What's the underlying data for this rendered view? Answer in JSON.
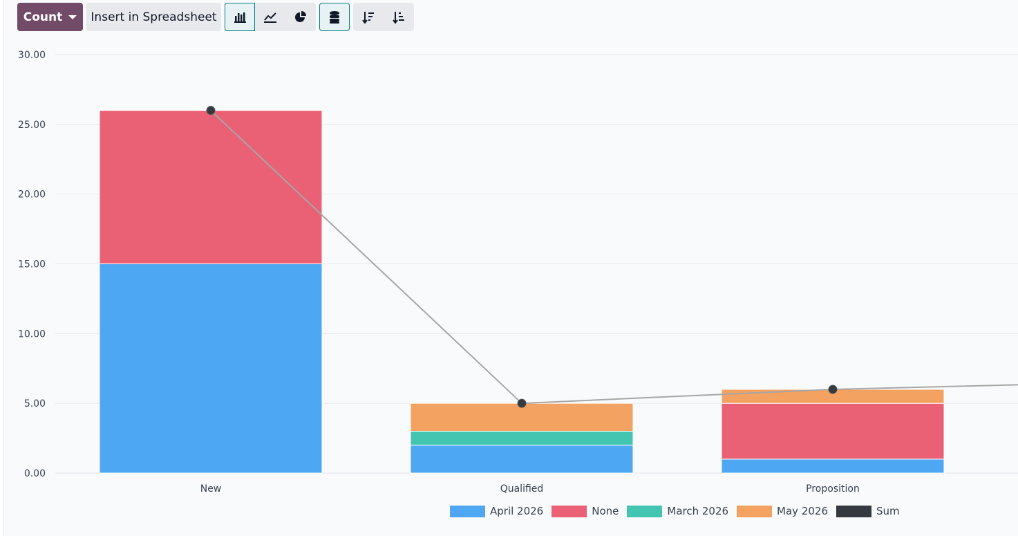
{
  "toolbar": {
    "measure_label": "Count",
    "insert_label": "Insert in Spreadsheet",
    "icons": [
      "bar-chart-icon",
      "line-chart-icon",
      "pie-chart-icon",
      "stacked-icon",
      "sort-descending-icon",
      "sort-ascending-icon"
    ]
  },
  "colors": {
    "accent": "#714b67",
    "active_border": "#017e84",
    "grid": "#e5e7eb",
    "sum_line": "#a6a6a6",
    "sum_point": "#343a40"
  },
  "chart_data": {
    "type": "bar",
    "stacked": true,
    "categories": [
      "New",
      "Qualified",
      "Proposition"
    ],
    "ylim": [
      0,
      30
    ],
    "yticks": [
      "0.00",
      "5.00",
      "10.00",
      "15.00",
      "20.00",
      "25.00",
      "30.00"
    ],
    "grid": true,
    "legend_position": "bottom",
    "series": [
      {
        "name": "April 2026",
        "color": "#4ea7f2",
        "values": [
          15,
          2,
          1
        ]
      },
      {
        "name": "None",
        "color": "#ea6175",
        "values": [
          11,
          0,
          4
        ]
      },
      {
        "name": "March 2026",
        "color": "#43c5b1",
        "values": [
          0,
          1,
          0
        ]
      },
      {
        "name": "May 2026",
        "color": "#f4a261",
        "values": [
          0,
          2,
          1
        ]
      }
    ],
    "line_series": {
      "name": "Sum",
      "color": "#343a40",
      "values": [
        26,
        5,
        6
      ]
    }
  }
}
